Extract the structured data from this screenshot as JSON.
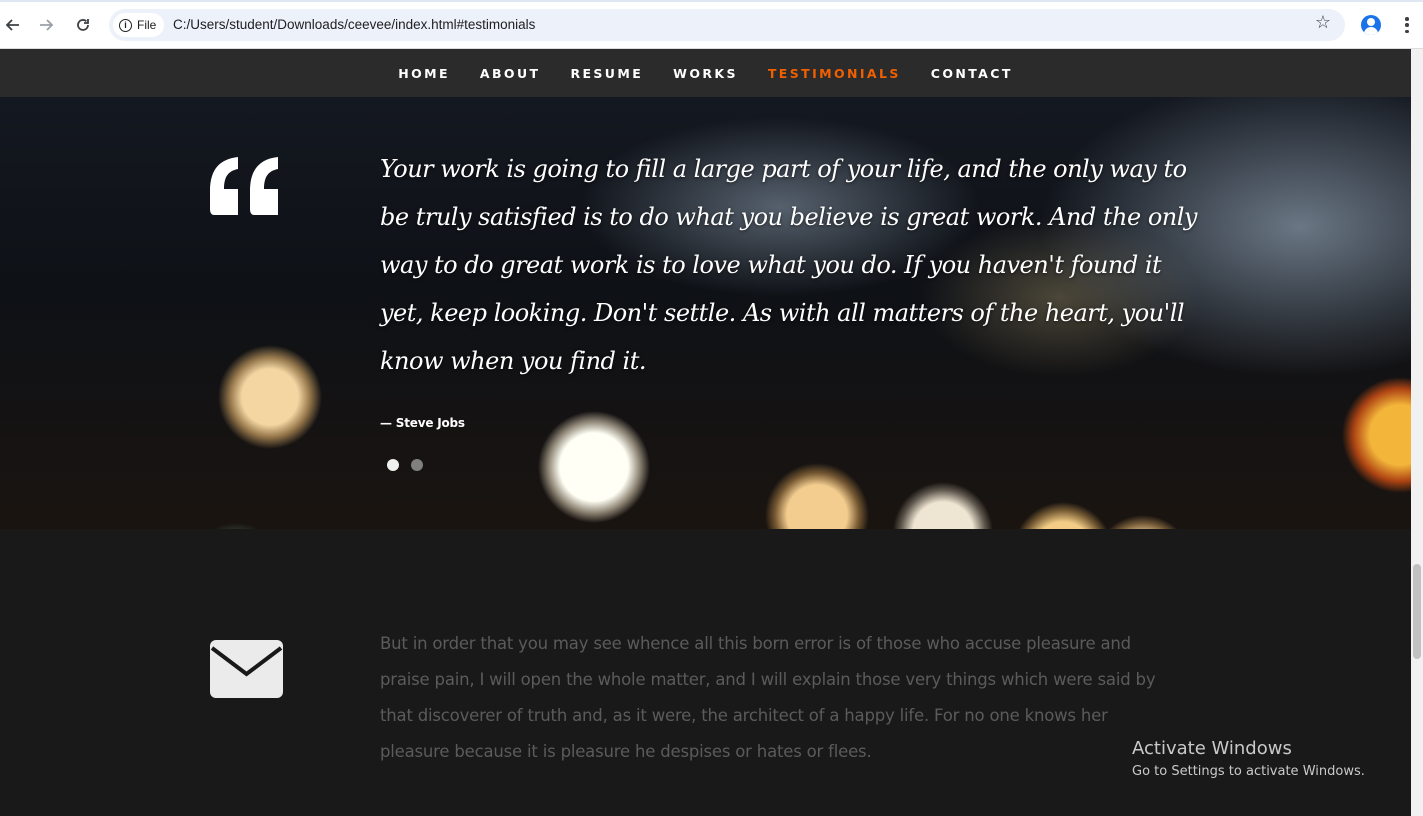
{
  "browser": {
    "back_icon": "arrow-left-icon",
    "forward_icon": "arrow-right-icon",
    "reload_icon": "reload-icon",
    "site_info_label": "File",
    "url": "C:/Users/student/Downloads/ceevee/index.html#testimonials",
    "bookmark_icon": "star-icon",
    "profile_icon": "person-icon",
    "menu_icon": "kebab-menu-icon"
  },
  "nav": {
    "items": [
      {
        "label": "HOME"
      },
      {
        "label": "ABOUT"
      },
      {
        "label": "RESUME"
      },
      {
        "label": "WORKS"
      },
      {
        "label": "TESTIMONIALS",
        "active": true
      },
      {
        "label": "CONTACT"
      }
    ],
    "active_color": "#f06000"
  },
  "testimonial": {
    "icon": "quote-icon",
    "quote": "Your work is going to fill a large part of your life, and the only way to be truly satisfied is to do what you believe is great work. And the only way to do great work is to love what you do. If you haven't found it yet, keep looking. Don't settle. As with all matters of the heart, you'll know when you find it.",
    "author": "— Steve Jobs",
    "slides": 2,
    "current_slide": 1
  },
  "cta": {
    "icon": "envelope-icon",
    "text": "But in order that you may see whence all this born error is of those who accuse pleasure and praise pain, I will open the whole matter, and I will explain those very things which were said by that discoverer of truth and, as it were, the architect of a happy life. For no one knows her pleasure because it is pleasure he despises or hates or flees."
  },
  "watermark": {
    "title": "Activate Windows",
    "subtitle": "Go to Settings to activate Windows."
  }
}
